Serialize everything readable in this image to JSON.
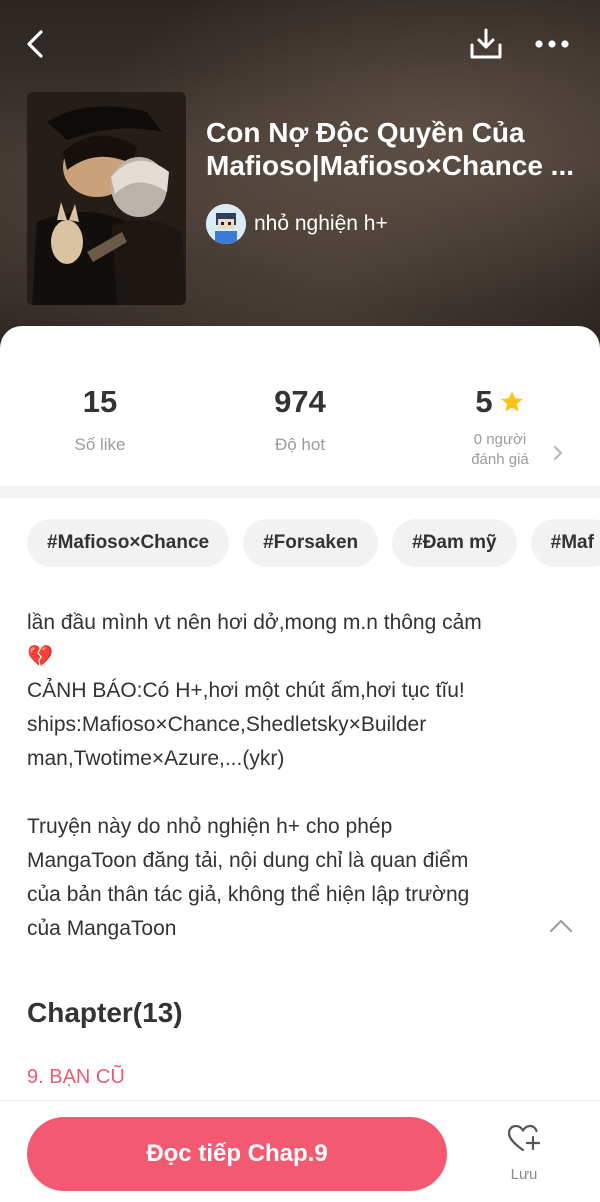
{
  "header": {
    "title": "Con Nợ Độc Quyền Của Mafioso|Mafioso×Chance ...",
    "author": "nhỏ nghiện h+"
  },
  "icons": {
    "back": "back-arrow-icon",
    "download": "download-icon",
    "more": "more-icon",
    "star": "star-icon",
    "chevron": "chevron-right-icon",
    "collapse": "chevron-up-icon",
    "save": "heart-plus-icon"
  },
  "colors": {
    "accent": "#f35a72",
    "chapter": "#ee5a73",
    "star": "#ffc21a"
  },
  "stats": {
    "likes": {
      "value": "15",
      "label": "Số like"
    },
    "hot": {
      "value": "974",
      "label": "Độ hot"
    },
    "rating": {
      "value": "5",
      "label_line1": "0 người",
      "label_line2": "đánh giá"
    }
  },
  "tags": [
    "#Mafioso×Chance",
    "#Forsaken",
    "#Đam mỹ",
    "#Maf"
  ],
  "description": {
    "line1": "lần đầu mình vt nên hơi dở,mong m.n thông cảm",
    "emoji": "💔",
    "line2": "CẢNH BÁO:Có H+,hơi một chút ấm,hơi tục tĩu!",
    "line3": "ships:Mafioso×Chance,Shedletsky×Builder",
    "line4": "man,Twotime×Azure,...(ykr)",
    "notice1": "Truyện này do nhỏ nghiện h+  cho phép",
    "notice2": "MangaToon đăng tải, nội dung chỉ là quan điểm",
    "notice3": "của bản thân tác giả, không thể hiện lập trường",
    "notice4": "của MangaToon"
  },
  "chapters": {
    "heading": "Chapter(13)",
    "latest": "9. BẠN CŨ"
  },
  "bottom": {
    "read_label": "Đọc tiếp Chap.9",
    "save_label": "Lưu"
  }
}
